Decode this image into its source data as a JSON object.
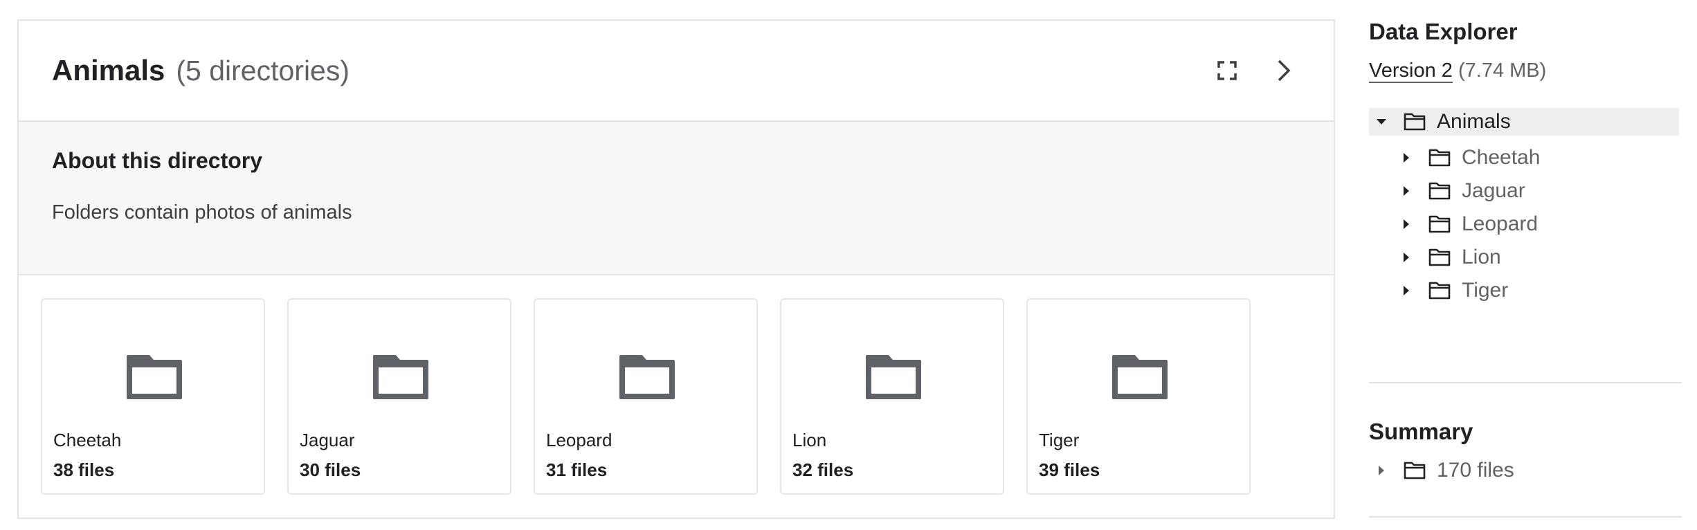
{
  "header": {
    "title": "Animals",
    "count": "(5 directories)"
  },
  "about": {
    "heading": "About this directory",
    "text": "Folders contain photos of animals"
  },
  "cards": [
    {
      "name": "Cheetah",
      "count": "38 files"
    },
    {
      "name": "Jaguar",
      "count": "30 files"
    },
    {
      "name": "Leopard",
      "count": "31 files"
    },
    {
      "name": "Lion",
      "count": "32 files"
    },
    {
      "name": "Tiger",
      "count": "39 files"
    }
  ],
  "sidebar": {
    "title": "Data Explorer",
    "version_link": "Version 2",
    "version_size": "(7.74 MB)",
    "tree": {
      "root": "Animals",
      "children": [
        "Cheetah",
        "Jaguar",
        "Leopard",
        "Lion",
        "Tiger"
      ]
    },
    "summary_title": "Summary",
    "summary_files": "170 files"
  },
  "icons": {
    "fullscreen": "fullscreen-icon",
    "next": "chevron-right-icon",
    "folder": "folder-icon",
    "caret_down": "caret-down-icon",
    "caret_right": "caret-right-icon"
  },
  "colors": {
    "folder_fill": "#5f6368",
    "about_bg": "#f7f7f7",
    "border": "#e3e3e3",
    "selected_bg": "#eeeeee"
  }
}
